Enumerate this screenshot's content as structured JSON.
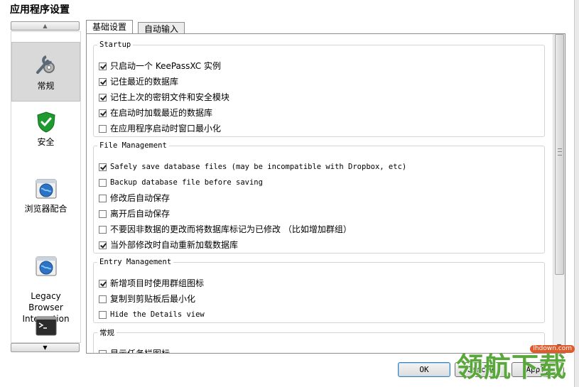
{
  "window": {
    "title": "应用程序设置"
  },
  "sidebar": {
    "items": [
      {
        "label": "常规",
        "icon": "wrench-gear-icon",
        "selected": true
      },
      {
        "label": "安全",
        "icon": "shield-check-icon",
        "selected": false
      },
      {
        "label": "浏览器配合",
        "icon": "browser-globe-icon",
        "selected": false
      },
      {
        "label": "Legacy\nBrowser\nIntegration",
        "icon": "legacy-browser-globe-icon",
        "selected": false
      },
      {
        "label": "",
        "icon": "terminal-icon",
        "selected": false
      }
    ]
  },
  "tabs": [
    {
      "label": "基础设置",
      "active": true
    },
    {
      "label": "自动输入",
      "active": false
    }
  ],
  "groups": {
    "startup": {
      "title": "Startup",
      "options": [
        {
          "label": "只启动一个 KeePassXC 实例",
          "checked": true
        },
        {
          "label": "记住最近的数据库",
          "checked": true
        },
        {
          "label": "记住上次的密钥文件和安全模块",
          "checked": true
        },
        {
          "label": "在启动时加载最近的数据库",
          "checked": true
        },
        {
          "label": "在应用程序启动时窗口最小化",
          "checked": false
        }
      ]
    },
    "file_management": {
      "title": "File Management",
      "options": [
        {
          "label": "Safely save database files (may be incompatible with Dropbox, etc)",
          "checked": true
        },
        {
          "label": "Backup database file before saving",
          "checked": false
        },
        {
          "label": "修改后自动保存",
          "checked": false
        },
        {
          "label": "离开后自动保存",
          "checked": false
        },
        {
          "label": "不要因非数据的更改而将数据库标记为已修改 （比如增加群组）",
          "checked": false
        },
        {
          "label": "当外部修改时自动重新加载数据库",
          "checked": true
        }
      ]
    },
    "entry_management": {
      "title": "Entry Management",
      "options": [
        {
          "label": "新增项目时使用群组图标",
          "checked": true
        },
        {
          "label": "复制到剪贴板后最小化",
          "checked": false
        },
        {
          "label": "Hide the Details view",
          "checked": false
        }
      ]
    },
    "general": {
      "title": "常规",
      "options": [
        {
          "label": "显示任务栏图标",
          "checked": false
        }
      ]
    }
  },
  "buttons": {
    "ok": "OK",
    "cancel": "Cancel",
    "apply": "Apply"
  },
  "watermark": {
    "text": "领航下载",
    "url": "lhdown.com"
  },
  "colors": {
    "watermark_green": "#5aa83c",
    "watermark_badge": "#e05a2a",
    "selected_bg": "#d9d9d9"
  }
}
